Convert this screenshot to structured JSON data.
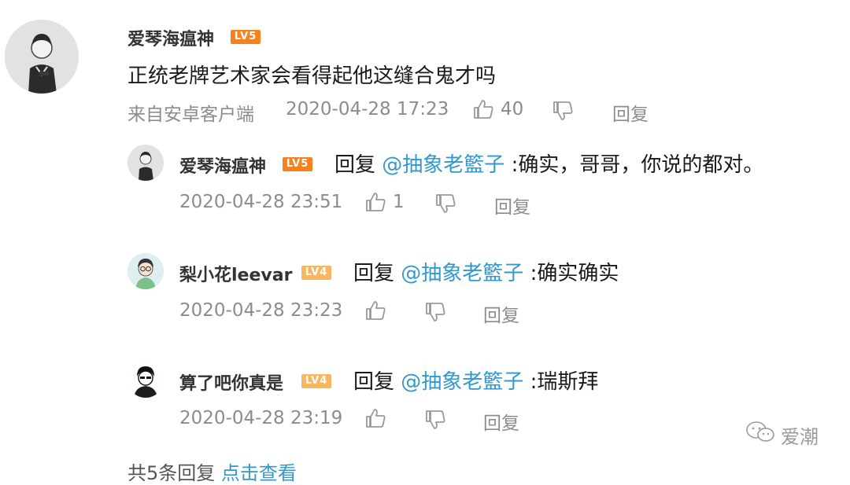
{
  "comment": {
    "username": "爱琴海瘟神",
    "level": "LV5",
    "text": "正统老牌艺术家会看得起他这缝合鬼才吗",
    "source": "来自安卓客户端",
    "timestamp": "2020-04-28 17:23",
    "likes": "40",
    "reply_label": "回复"
  },
  "replies": [
    {
      "username": "爱琴海瘟神",
      "level": "LV5",
      "reply_prefix": "回复",
      "mention": "@抽象老籃子",
      "text": ":确实，哥哥，你说的都对。",
      "timestamp": "2020-04-28 23:51",
      "likes": "1",
      "reply_label": "回复"
    },
    {
      "username": "梨小花leevar",
      "level": "LV4",
      "reply_prefix": "回复",
      "mention": "@抽象老籃子",
      "text": ":确实确实",
      "timestamp": "2020-04-28 23:23",
      "likes": "",
      "reply_label": "回复"
    },
    {
      "username": "算了吧你真是",
      "level": "LV4",
      "reply_prefix": "回复",
      "mention": "@抽象老籃子",
      "text": ":瑞斯拜",
      "timestamp": "2020-04-28 23:19",
      "likes": "",
      "reply_label": "回复"
    }
  ],
  "footer": {
    "count_text": "共5条回复",
    "view_link": "点击查看"
  },
  "watermark": "爱潮",
  "colors": {
    "mention": "#3399cc",
    "lv5_badge": "#f5821f",
    "lv4_badge": "#f7b760",
    "meta_text": "#8c8c8c"
  }
}
